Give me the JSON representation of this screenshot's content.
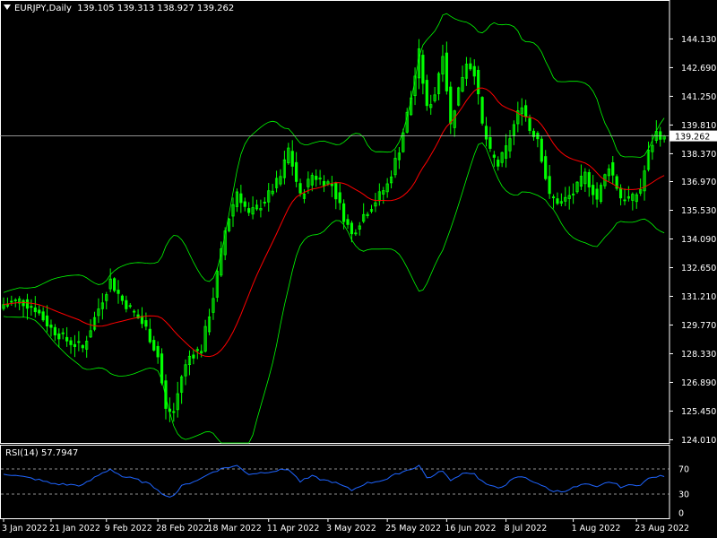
{
  "header": {
    "symbol": "EURJPY,Daily",
    "ohlc": "139.105 139.313 138.927 139.262"
  },
  "rsi_header": "RSI(14) 57.7947",
  "price_label": "139.262",
  "colors": {
    "background": "#000000",
    "frame": "#ffffff",
    "candle": "#00ff00",
    "ma": "#ff0000",
    "bands": "#00ff00",
    "rsi": "#1e64ff",
    "level_line": "#c0c0c0",
    "text": "#ffffff"
  },
  "chart_data": [
    {
      "type": "candlestick",
      "symbol": "EURJPY",
      "timeframe": "Daily",
      "y_ticks": [
        "144.130",
        "142.690",
        "141.250",
        "139.810",
        "138.370",
        "136.970",
        "135.530",
        "134.090",
        "132.650",
        "131.210",
        "129.770",
        "128.330",
        "126.890",
        "125.450",
        "124.010"
      ],
      "ylim": [
        123.85,
        145.86
      ],
      "x_ticks": [
        "3 Jan 2022",
        "21 Jan 2022",
        "9 Feb 2022",
        "28 Feb 2022",
        "18 Mar 2022",
        "11 Apr 2022",
        "3 May 2022",
        "25 May 2022",
        "16 Jun 2022",
        "8 Jul 2022",
        "1 Aug 2022",
        "23 Aug 2022"
      ],
      "x_tick_bar_index": [
        0,
        12,
        26,
        39,
        52,
        67,
        82,
        97,
        112,
        127,
        144,
        160
      ],
      "current_price": 139.262,
      "close_anchors": [
        [
          0,
          130.8
        ],
        [
          4,
          131.0
        ],
        [
          8,
          130.6
        ],
        [
          12,
          129.6
        ],
        [
          16,
          129.0
        ],
        [
          20,
          128.6
        ],
        [
          24,
          130.6
        ],
        [
          27,
          132.0
        ],
        [
          30,
          131.0
        ],
        [
          33,
          130.4
        ],
        [
          36,
          129.6
        ],
        [
          39,
          128.2
        ],
        [
          41,
          125.5
        ],
        [
          43,
          125.4
        ],
        [
          45,
          127.2
        ],
        [
          47,
          128.2
        ],
        [
          50,
          128.6
        ],
        [
          53,
          131.2
        ],
        [
          56,
          134.5
        ],
        [
          59,
          136.5
        ],
        [
          62,
          135.3
        ],
        [
          65,
          135.8
        ],
        [
          67,
          136.3
        ],
        [
          70,
          137.2
        ],
        [
          72,
          138.6
        ],
        [
          75,
          136.2
        ],
        [
          78,
          137.3
        ],
        [
          81,
          137.0
        ],
        [
          83,
          136.8
        ],
        [
          86,
          135.2
        ],
        [
          88,
          134.3
        ],
        [
          91,
          135.3
        ],
        [
          94,
          136.0
        ],
        [
          97,
          136.8
        ],
        [
          100,
          138.6
        ],
        [
          103,
          141.2
        ],
        [
          105,
          143.4
        ],
        [
          107,
          140.6
        ],
        [
          109,
          141.4
        ],
        [
          111,
          143.5
        ],
        [
          113,
          139.8
        ],
        [
          115,
          141.6
        ],
        [
          117,
          143.0
        ],
        [
          119,
          142.5
        ],
        [
          121,
          139.8
        ],
        [
          123,
          138.4
        ],
        [
          125,
          137.8
        ],
        [
          127,
          138.6
        ],
        [
          129,
          139.8
        ],
        [
          131,
          140.9
        ],
        [
          133,
          139.6
        ],
        [
          135,
          139.2
        ],
        [
          138,
          136.2
        ],
        [
          141,
          135.9
        ],
        [
          144,
          136.4
        ],
        [
          147,
          137.3
        ],
        [
          150,
          136.1
        ],
        [
          153,
          137.8
        ],
        [
          156,
          136.2
        ],
        [
          159,
          136.1
        ],
        [
          161,
          136.6
        ],
        [
          163,
          138.4
        ],
        [
          165,
          139.4
        ],
        [
          167,
          139.26
        ]
      ],
      "indicators": [
        "Moving Average",
        "Bollinger Bands"
      ]
    },
    {
      "type": "line",
      "title": "RSI(14) 57.7947",
      "y_ticks": [
        "70",
        "30",
        "0"
      ],
      "levels": [
        70,
        30
      ],
      "ylim": [
        0,
        100
      ],
      "rsi_anchors": [
        [
          0,
          63
        ],
        [
          4,
          58
        ],
        [
          8,
          54
        ],
        [
          12,
          47
        ],
        [
          16,
          45
        ],
        [
          20,
          44
        ],
        [
          24,
          60
        ],
        [
          27,
          70
        ],
        [
          30,
          58
        ],
        [
          33,
          54
        ],
        [
          36,
          48
        ],
        [
          39,
          38
        ],
        [
          41,
          26
        ],
        [
          43,
          28
        ],
        [
          45,
          42
        ],
        [
          47,
          48
        ],
        [
          50,
          55
        ],
        [
          53,
          66
        ],
        [
          56,
          72
        ],
        [
          59,
          75
        ],
        [
          62,
          62
        ],
        [
          65,
          64
        ],
        [
          67,
          66
        ],
        [
          70,
          68
        ],
        [
          72,
          70
        ],
        [
          75,
          50
        ],
        [
          78,
          58
        ],
        [
          81,
          52
        ],
        [
          83,
          50
        ],
        [
          86,
          42
        ],
        [
          88,
          36
        ],
        [
          91,
          46
        ],
        [
          94,
          50
        ],
        [
          97,
          54
        ],
        [
          100,
          64
        ],
        [
          103,
          70
        ],
        [
          105,
          76
        ],
        [
          107,
          56
        ],
        [
          109,
          60
        ],
        [
          111,
          68
        ],
        [
          113,
          50
        ],
        [
          115,
          60
        ],
        [
          117,
          65
        ],
        [
          119,
          62
        ],
        [
          121,
          50
        ],
        [
          123,
          42
        ],
        [
          125,
          40
        ],
        [
          127,
          46
        ],
        [
          129,
          54
        ],
        [
          131,
          58
        ],
        [
          133,
          52
        ],
        [
          135,
          48
        ],
        [
          138,
          36
        ],
        [
          141,
          34
        ],
        [
          144,
          40
        ],
        [
          147,
          46
        ],
        [
          150,
          40
        ],
        [
          153,
          50
        ],
        [
          156,
          42
        ],
        [
          159,
          44
        ],
        [
          161,
          46
        ],
        [
          163,
          54
        ],
        [
          165,
          58
        ],
        [
          167,
          57.79
        ]
      ]
    }
  ]
}
